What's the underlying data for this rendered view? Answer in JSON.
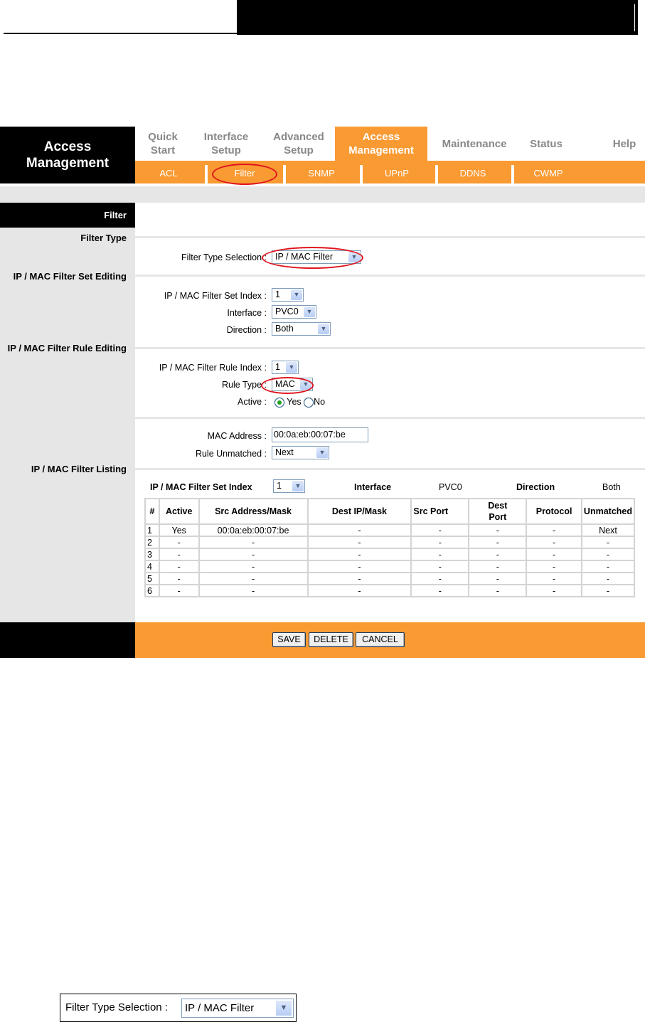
{
  "page_title": "Access Management",
  "nav": [
    {
      "label1": "Quick",
      "label2": "Start"
    },
    {
      "label1": "Interface",
      "label2": "Setup"
    },
    {
      "label1": "Advanced",
      "label2": "Setup"
    },
    {
      "label1": "Access",
      "label2": "Management"
    },
    {
      "label1": "Maintenance",
      "label2": ""
    },
    {
      "label1": "Status",
      "label2": ""
    },
    {
      "label1": "Help",
      "label2": ""
    }
  ],
  "subnav": [
    "ACL",
    "Filter",
    "SNMP",
    "UPnP",
    "DDNS",
    "CWMP"
  ],
  "section_header": "Filter",
  "sections": [
    "Filter Type",
    "IP / MAC Filter Set Editing",
    "IP / MAC Filter Rule Editing",
    "IP / MAC Filter Listing"
  ],
  "form": {
    "filter_type_label": "Filter Type Selection :",
    "filter_type_value": "IP / MAC Filter",
    "set_index_label": "IP / MAC Filter Set Index :",
    "set_index_value": "1",
    "interface_label": "Interface :",
    "interface_value": "PVC0",
    "direction_label": "Direction :",
    "direction_value": "Both",
    "rule_index_label": "IP / MAC Filter Rule Index :",
    "rule_index_value": "1",
    "rule_type_label": "Rule Type :",
    "rule_type_value": "MAC",
    "active_label": "Active :",
    "active_yes": "Yes",
    "active_no": "No",
    "mac_label": "MAC Address :",
    "mac_value": "00:0a:eb:00:07:be",
    "unmatched_label": "Rule Unmatched :",
    "unmatched_value": "Next"
  },
  "listing": {
    "set_index_label": "IP / MAC Filter Set Index",
    "set_index_value": "1",
    "interface_label": "Interface",
    "interface_value": "PVC0",
    "direction_label": "Direction",
    "direction_value": "Both",
    "columns": [
      "#",
      "Active",
      "Src Address/Mask",
      "Dest IP/Mask",
      "Src Port",
      "Dest Port",
      "Protocol",
      "Unmatched"
    ],
    "rows": [
      [
        "1",
        "Yes",
        "00:0a:eb:00:07:be",
        "-",
        "-",
        "-",
        "-",
        "Next"
      ],
      [
        "2",
        "-",
        "-",
        "-",
        "-",
        "-",
        "-",
        "-"
      ],
      [
        "3",
        "-",
        "-",
        "-",
        "-",
        "-",
        "-",
        "-"
      ],
      [
        "4",
        "-",
        "-",
        "-",
        "-",
        "-",
        "-",
        "-"
      ],
      [
        "5",
        "-",
        "-",
        "-",
        "-",
        "-",
        "-",
        "-"
      ],
      [
        "6",
        "-",
        "-",
        "-",
        "-",
        "-",
        "-",
        "-"
      ]
    ]
  },
  "buttons": {
    "save": "SAVE",
    "delete": "DELETE",
    "cancel": "CANCEL"
  },
  "snippet": {
    "label": "Filter Type Selection :",
    "value": "IP / MAC Filter"
  }
}
